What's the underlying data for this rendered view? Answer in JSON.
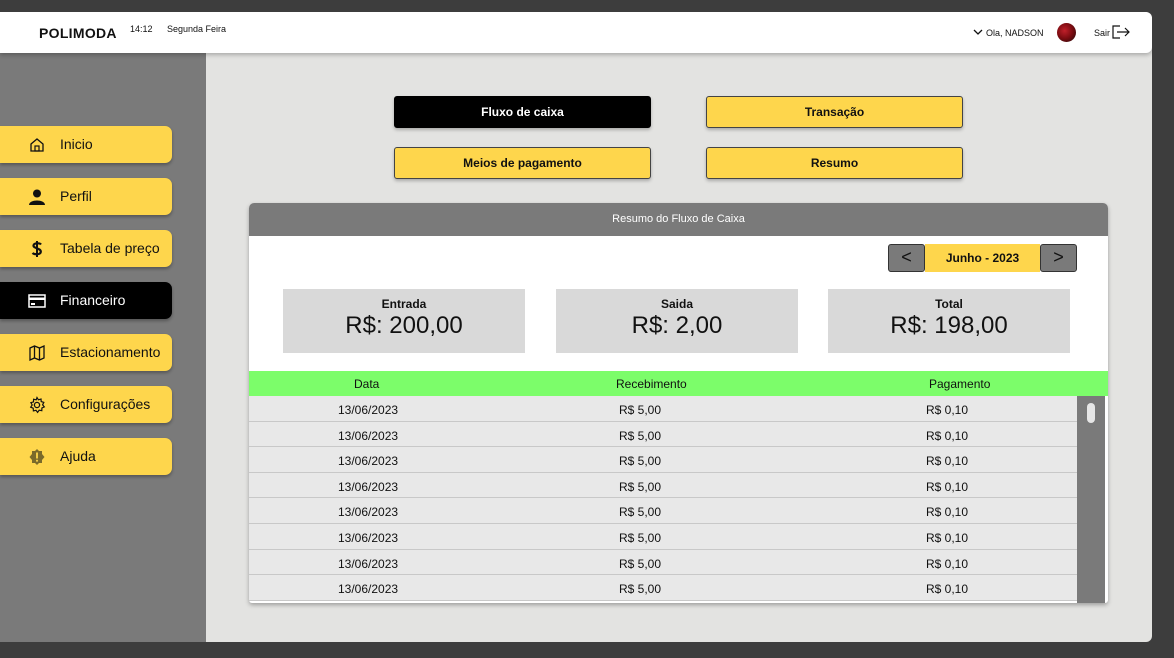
{
  "header": {
    "brand": "POLIMODA",
    "time": "14:12",
    "day": "Segunda Feira",
    "greeting": "Ola, NADSON",
    "logout_label": "Sair"
  },
  "sidebar": {
    "items": [
      {
        "label": "Inicio",
        "icon": "home-icon"
      },
      {
        "label": "Perfil",
        "icon": "user-icon"
      },
      {
        "label": "Tabela de preço",
        "icon": "dollar-icon"
      },
      {
        "label": "Financeiro",
        "icon": "card-icon",
        "active": true
      },
      {
        "label": "Estacionamento",
        "icon": "map-icon"
      },
      {
        "label": "Configurações",
        "icon": "gear-icon"
      },
      {
        "label": "Ajuda",
        "icon": "alert-icon"
      }
    ]
  },
  "actions": {
    "fluxo": "Fluxo de caixa",
    "transacao": "Transação",
    "meios": "Meios de pagamento",
    "resumo": "Resumo"
  },
  "panel": {
    "title": "Resumo do Fluxo de Caixa",
    "month": "Junho - 2023",
    "prev": "<",
    "next": ">",
    "stats": {
      "entrada": {
        "label": "Entrada",
        "value": "R$: 200,00"
      },
      "saida": {
        "label": "Saida",
        "value": "R$: 2,00"
      },
      "total": {
        "label": "Total",
        "value": "R$: 198,00"
      }
    },
    "columns": [
      "Data",
      "Recebimento",
      "Pagamento"
    ],
    "rows": [
      [
        "13/06/2023",
        "R$ 5,00",
        "R$ 0,10"
      ],
      [
        "13/06/2023",
        "R$ 5,00",
        "R$ 0,10"
      ],
      [
        "13/06/2023",
        "R$ 5,00",
        "R$ 0,10"
      ],
      [
        "13/06/2023",
        "R$ 5,00",
        "R$ 0,10"
      ],
      [
        "13/06/2023",
        "R$ 5,00",
        "R$ 0,10"
      ],
      [
        "13/06/2023",
        "R$ 5,00",
        "R$ 0,10"
      ],
      [
        "13/06/2023",
        "R$ 5,00",
        "R$ 0,10"
      ],
      [
        "13/06/2023",
        "R$ 5,00",
        "R$ 0,10"
      ]
    ]
  },
  "colors": {
    "accent": "#fed64c",
    "sidebar": "#7a7a7a",
    "table_header": "#7cfd6a",
    "active": "#000000"
  }
}
